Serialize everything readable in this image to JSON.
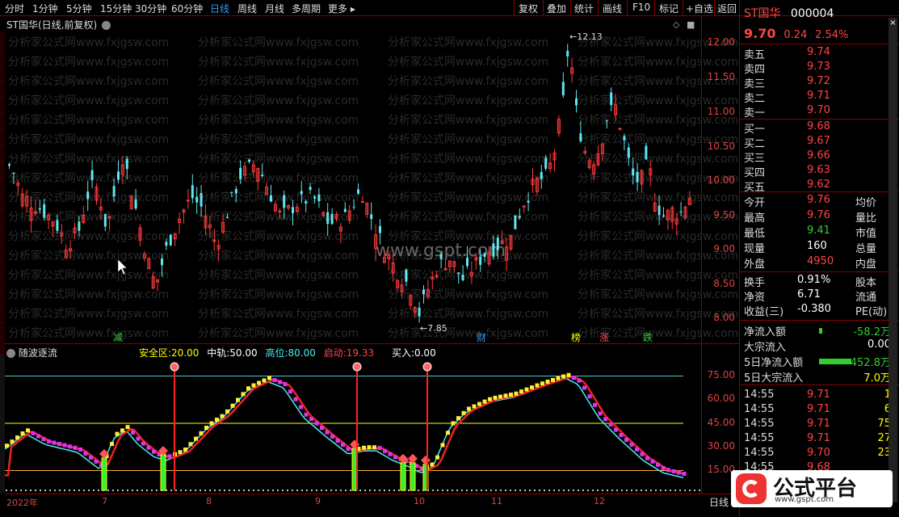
{
  "toolbar": {
    "periods": [
      "分时",
      "1分钟",
      "5分钟",
      "15分钟",
      "30分钟",
      "60分钟",
      "日线",
      "周线",
      "月线",
      "多周期",
      "更多 ▸"
    ],
    "actions": [
      "复权",
      "叠加",
      "统计",
      "画线",
      "F10",
      "标记",
      "+自选",
      "返回"
    ]
  },
  "main_chart": {
    "title": "ST国华(日线,前复权)",
    "high_label": "12.13",
    "low_label": "7.85",
    "y_ticks": [
      "12.00",
      "11.50",
      "11.00",
      "10.50",
      "10.00",
      "9.50",
      "9.00",
      "8.50",
      "8.00"
    ],
    "markers": [
      "减",
      "财",
      "榜",
      "涨",
      "跌"
    ],
    "watermark_row": "分析家公式网www.fxjgsw.com",
    "center_watermark": "www.gspt.com"
  },
  "indicator": {
    "name": "随波逐流",
    "safe_label": "安全区:",
    "safe_value": "20.00",
    "mid_label": "中轨:",
    "mid_value": "50.00",
    "high_label": "高位:",
    "high_value": "80.00",
    "start_label": "启动:",
    "start_value": "19.33",
    "buy_label": "买入:",
    "buy_value": "0.00",
    "y_ticks": [
      "75.00",
      "60.00",
      "45.00",
      "30.00",
      "15.00"
    ]
  },
  "x_axis": [
    "2022年",
    "7",
    "8",
    "9",
    "10",
    "11",
    "12"
  ],
  "x_right": "日线",
  "quote": {
    "name": "ST国华",
    "code": "000004",
    "price": "9.70",
    "change": "0.24",
    "pct": "2.54%",
    "sell": [
      {
        "label": "卖五",
        "price": "9.74"
      },
      {
        "label": "卖四",
        "price": "9.73"
      },
      {
        "label": "卖三",
        "price": "9.72"
      },
      {
        "label": "卖二",
        "price": "9.71"
      },
      {
        "label": "卖一",
        "price": "9.70"
      }
    ],
    "buy": [
      {
        "label": "买一",
        "price": "9.68"
      },
      {
        "label": "买二",
        "price": "9.67"
      },
      {
        "label": "买三",
        "price": "9.66"
      },
      {
        "label": "买四",
        "price": "9.63"
      },
      {
        "label": "买五",
        "price": "9.62"
      }
    ],
    "stats": [
      {
        "l1": "今开",
        "v1": "9.76",
        "l2": "均价"
      },
      {
        "l1": "最高",
        "v1": "9.76",
        "l2": "量比"
      },
      {
        "l1": "最低",
        "v1": "9.41",
        "l2": "市值"
      },
      {
        "l1": "现量",
        "v1": "160",
        "l2": "总量"
      },
      {
        "l1": "外盘",
        "v1": "4950",
        "l2": "内盘"
      }
    ],
    "stats2": [
      {
        "l1": "换手",
        "v1": "0.91%",
        "l2": "股本"
      },
      {
        "l1": "净资",
        "v1": "6.71",
        "l2": "流通"
      },
      {
        "l1": "收益(三)",
        "v1": "-0.380",
        "l2": "PE(动)"
      }
    ],
    "flows": [
      {
        "label": "净流入额",
        "value": "-58.2万"
      },
      {
        "label": "大宗流入",
        "value": "0.00"
      },
      {
        "label": "5日净流入额",
        "value": "-452.8万"
      },
      {
        "label": "5日大宗流入",
        "value": "7.0万"
      }
    ],
    "ticks": [
      {
        "time": "14:55",
        "price": "9.71",
        "vol": "1"
      },
      {
        "time": "14:55",
        "price": "9.71",
        "vol": "6"
      },
      {
        "time": "14:55",
        "price": "9.71",
        "vol": "75"
      },
      {
        "time": "14:55",
        "price": "9.71",
        "vol": "27"
      },
      {
        "time": "14:55",
        "price": "9.70",
        "vol": "23"
      },
      {
        "time": "14:55",
        "price": "9.68",
        "vol": ""
      }
    ]
  },
  "logo": {
    "text": "公式平台",
    "url": "www.gspt.com"
  }
}
